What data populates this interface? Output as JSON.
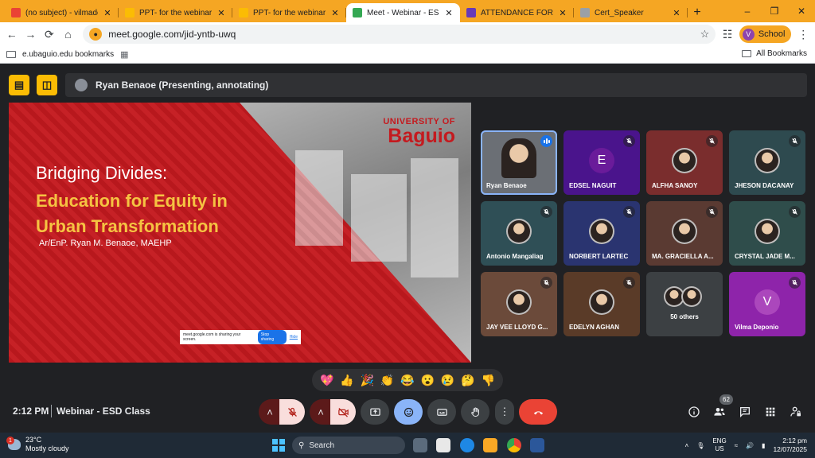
{
  "browser": {
    "tabs": [
      {
        "title": "(no subject) - vilmadepon",
        "color": "#ea4335"
      },
      {
        "title": "PPT- for the webinar",
        "color": "#fbbc04"
      },
      {
        "title": "PPT- for the webinar",
        "color": "#fbbc04"
      },
      {
        "title": "Meet - Webinar - ESD",
        "color": "#34a853",
        "active": true
      },
      {
        "title": "ATTENDANCE FORM FOR",
        "color": "#673ab7"
      },
      {
        "title": "Cert_Speaker",
        "color": "#9aa0a6"
      }
    ],
    "new_tab": "+",
    "url": "meet.google.com/jid-yntb-uwq",
    "profile_initial": "V",
    "profile_label": "School",
    "bookmark_folder": "e.ubaguio.edu bookmarks",
    "all_bookmarks": "All Bookmarks"
  },
  "meet": {
    "presenter_bar": "Ryan Benaoe (Presenting, annotating)",
    "slide": {
      "logo_line1": "UNIVERSITY OF",
      "logo_line2": "Baguio",
      "title_line1": "Bridging Divides:",
      "title_line2": "Education for Equity in Urban Transformation",
      "author": "Ar/EnP. Ryan M. Benaoe, MAEHP",
      "share_notice": "meet.google.com is sharing your screen.",
      "stop_sharing": "Stop sharing",
      "hide": "Hide"
    },
    "participants": [
      {
        "name": "Ryan Benaoe",
        "speaking": true,
        "bg": "#6b6f75"
      },
      {
        "name": "EDSEL NAGUIT",
        "letter": "E",
        "bg": "#4a148c",
        "circle": "#6a1b9a"
      },
      {
        "name": "ALFHA SANOY",
        "bg": "#7a2d2d"
      },
      {
        "name": "JHESON DACANAY",
        "bg": "#2e4a4f"
      },
      {
        "name": "Antonio Mangaliag",
        "bg": "#2f4f56"
      },
      {
        "name": "NORBERT LARTEC",
        "bg": "#2a3470"
      },
      {
        "name": "MA. GRACIELLA A...",
        "bg": "#5a3a32"
      },
      {
        "name": "CRYSTAL JADE M...",
        "bg": "#2f4d4b"
      },
      {
        "name": "JAY VEE LLOYD G...",
        "bg": "#6b4a3a"
      },
      {
        "name": "EDELYN AGHAN",
        "bg": "#5a3b28"
      },
      {
        "name": "50 others",
        "bg": "#3c4043"
      },
      {
        "name": "Vilma Deponio",
        "letter": "V",
        "bg": "#8e24aa",
        "circle": "#ab47bc"
      }
    ],
    "reactions": [
      "💖",
      "👍",
      "🎉",
      "👏",
      "😂",
      "😮",
      "😢",
      "🤔",
      "👎"
    ],
    "time": "2:12 PM",
    "meeting_name": "Webinar - ESD Class",
    "people_count": "62"
  },
  "taskbar": {
    "temp": "23°C",
    "weather": "Mostly cloudy",
    "weather_badge": "1",
    "search": "Search",
    "lang1": "ENG",
    "lang2": "US",
    "clock_time": "2:12 pm",
    "clock_date": "12/07/2025"
  }
}
